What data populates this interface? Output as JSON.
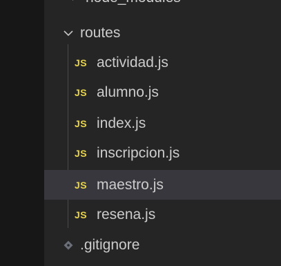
{
  "explorer": {
    "partial_item": {
      "label": "node_modules"
    },
    "folder": {
      "label": "routes",
      "expanded": true
    },
    "files": [
      {
        "label": "actividad.js",
        "badge": "JS"
      },
      {
        "label": "alumno.js",
        "badge": "JS"
      },
      {
        "label": "index.js",
        "badge": "JS"
      },
      {
        "label": "inscripcion.js",
        "badge": "JS"
      },
      {
        "label": "maestro.js",
        "badge": "JS",
        "selected": true
      },
      {
        "label": "resena.js",
        "badge": "JS"
      }
    ],
    "gitignore": {
      "label": ".gitignore"
    }
  },
  "colors": {
    "background": "#252526",
    "selected": "#37373d",
    "js_badge": "#e8d44d",
    "text": "#cccccc"
  }
}
